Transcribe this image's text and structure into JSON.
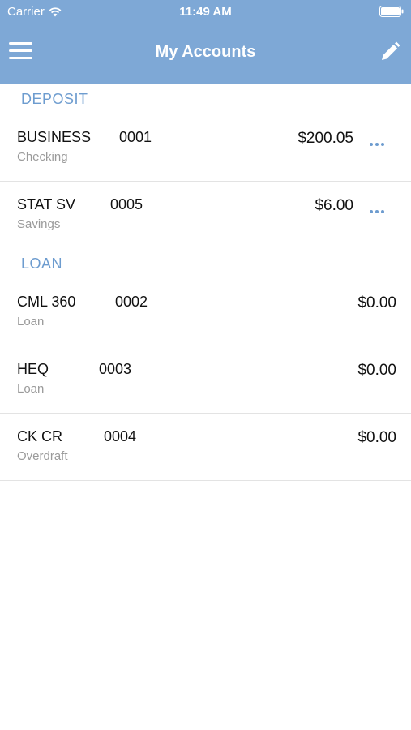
{
  "status_bar": {
    "carrier": "Carrier",
    "time": "11:49 AM"
  },
  "nav": {
    "title": "My Accounts",
    "menu_icon": "hamburger-menu-icon",
    "edit_icon": "pencil-icon"
  },
  "colors": {
    "header_bg": "#7ea8d6",
    "accent": "#6d9ccf",
    "secondary_text": "#9a9a9a"
  },
  "sections": [
    {
      "title": "DEPOSIT",
      "accounts": [
        {
          "name": "BUSINESS",
          "number": "0001",
          "type": "Checking",
          "amount": "$200.05",
          "has_more": true
        },
        {
          "name": "STAT SV",
          "number": "0005",
          "type": "Savings",
          "amount": "$6.00",
          "has_more": true
        }
      ]
    },
    {
      "title": "LOAN",
      "accounts": [
        {
          "name": "CML 360",
          "number": "0002",
          "type": "Loan",
          "amount": "$0.00",
          "has_more": false
        },
        {
          "name": "HEQ",
          "number": "0003",
          "type": "Loan",
          "amount": "$0.00",
          "has_more": false
        },
        {
          "name": "CK CR",
          "number": "0004",
          "type": "Overdraft",
          "amount": "$0.00",
          "has_more": false
        }
      ]
    }
  ]
}
